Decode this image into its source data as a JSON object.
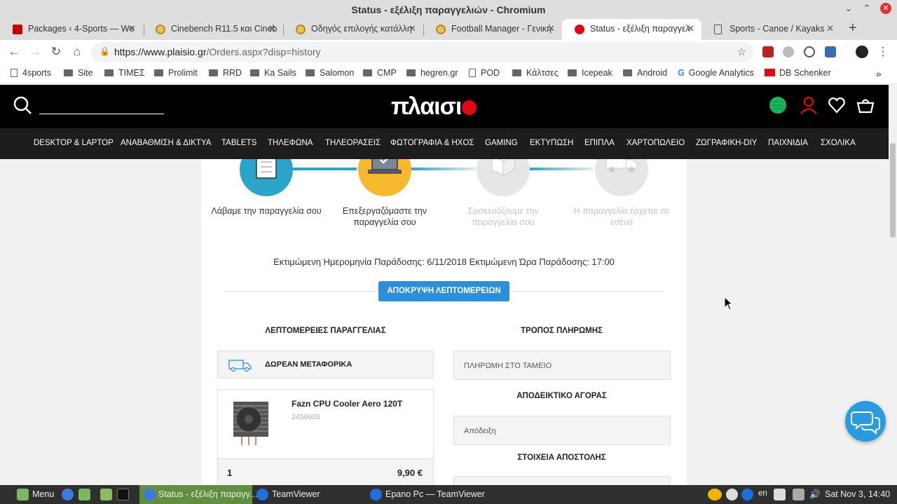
{
  "window": {
    "title": "Status - εξέλιξη παραγγελιών - Chromium"
  },
  "tabs": [
    {
      "label": "Packages ‹ 4-Sports — Wo",
      "icon": "4sports-favicon"
    },
    {
      "label": "Cinebench R11.5 και Cineb",
      "icon": "medal-favicon"
    },
    {
      "label": "Οδηγός επιλογής κατάλλη",
      "icon": "medal-favicon"
    },
    {
      "label": "Football Manager - Γενική",
      "icon": "medal-favicon"
    },
    {
      "label": "Status - εξέλιξη παραγγελ",
      "icon": "plaisio-favicon",
      "active": true
    },
    {
      "label": "Sports - Canoe / Kayaks",
      "icon": "page-favicon"
    }
  ],
  "address": {
    "url_host": "https://www.plaisio.gr",
    "url_path": "/Orders.aspx?disp=history"
  },
  "bookmarks": [
    {
      "label": "4sports",
      "type": "page"
    },
    {
      "label": "Site",
      "type": "folder"
    },
    {
      "label": "ΤΙΜΕΣ",
      "type": "folder"
    },
    {
      "label": "Prolimit",
      "type": "folder"
    },
    {
      "label": "RRD",
      "type": "folder"
    },
    {
      "label": "Ka Sails",
      "type": "folder"
    },
    {
      "label": "Salomon",
      "type": "folder"
    },
    {
      "label": "CMP",
      "type": "folder"
    },
    {
      "label": "hegren.gr",
      "type": "folder"
    },
    {
      "label": "POD",
      "type": "page"
    },
    {
      "label": "Κάλτσες",
      "type": "folder"
    },
    {
      "label": "Icepeak",
      "type": "folder"
    },
    {
      "label": "Android",
      "type": "folder"
    },
    {
      "label": "Google Analytics",
      "type": "google"
    },
    {
      "label": "DB Schenker",
      "type": "db"
    }
  ],
  "site": {
    "logo": "πλαισι",
    "categories": [
      "DESKTOP & LAPTOP",
      "ΑΝΑΒΑΘΜΙΣΗ & ΔΙΚΤΥΑ",
      "TABLETS",
      "ΤΗΛΕΦΩΝΑ",
      "ΤΗΛΕΟΡΑΣΕΙΣ",
      "ΦΩΤΟΓΡΑΦΙΑ & ΗΧΟΣ",
      "GAMING",
      "ΕΚΤΥΠΩΣΗ",
      "ΕΠΙΠΛΑ",
      "ΧΑΡΤΟΠΩΛΕΙΟ",
      "ΖΩΓΡΑΦΙΚΗ-DIY",
      "ΠΑΙΧΝΙΔΙΑ",
      "ΣΧΟΛΙΚΑ"
    ]
  },
  "order": {
    "steps": [
      {
        "label": "Λάβαμε την παραγγελία σου",
        "state": "done",
        "color": "#2aa5c9"
      },
      {
        "label": "Επεξεργαζόμαστε την παραγγελία σου",
        "state": "current",
        "color": "#f5b82e"
      },
      {
        "label": "Συσκευάζουμε την παραγγελία σου",
        "state": "pending",
        "color": "#e6e6e6"
      },
      {
        "label": "Η παραγγελία έρχεται σε εσένα",
        "state": "pending",
        "color": "#e6e6e6"
      }
    ],
    "estimate": "Εκτιμώμενη Ημερομηνία Παράδοσης: 6/11/2018 Εκτιμώμενη Ώρα Παράδοσης: 17:00",
    "hide_details_label": "ΑΠΟΚΡΥΨΗ ΛΕΠΤΟΜΕΡΕΙΩΝ",
    "details_title": "ΛΕΠΤΟΜΕΡΕΙΕΣ ΠΑΡΑΓΓΕΛΙΑΣ",
    "shipping_label": "ΔΩΡΕΑΝ ΜΕΤΑΦΟΡΙΚΑ",
    "payment_title": "ΤΡΟΠΟΣ ΠΛΗΡΩΜΗΣ",
    "payment_value": "ΠΛΗΡΩΜΗ ΣΤΟ ΤΑΜΕΙΟ",
    "receipt_title": "ΑΠΟΔΕΙΚΤΙΚΟ ΑΓΟΡΑΣ",
    "receipt_value": "Απόδειξη",
    "shipping_info_title": "ΣΤΟΙΧΕΙΑ ΑΠΟΣΤΟΛΗΣ",
    "product": {
      "name": "Fazn CPU Cooler Aero 120T",
      "code": "2456605",
      "qty": "1",
      "price": "9,90 €"
    }
  },
  "taskbar": {
    "menu_label": "Menu",
    "items": [
      "Status - εξέλιξη παραγγ...",
      "TeamViewer",
      "Epano Pc — TeamViewer"
    ],
    "lang": "en",
    "clock": "Sat Nov 3, 14:40"
  }
}
